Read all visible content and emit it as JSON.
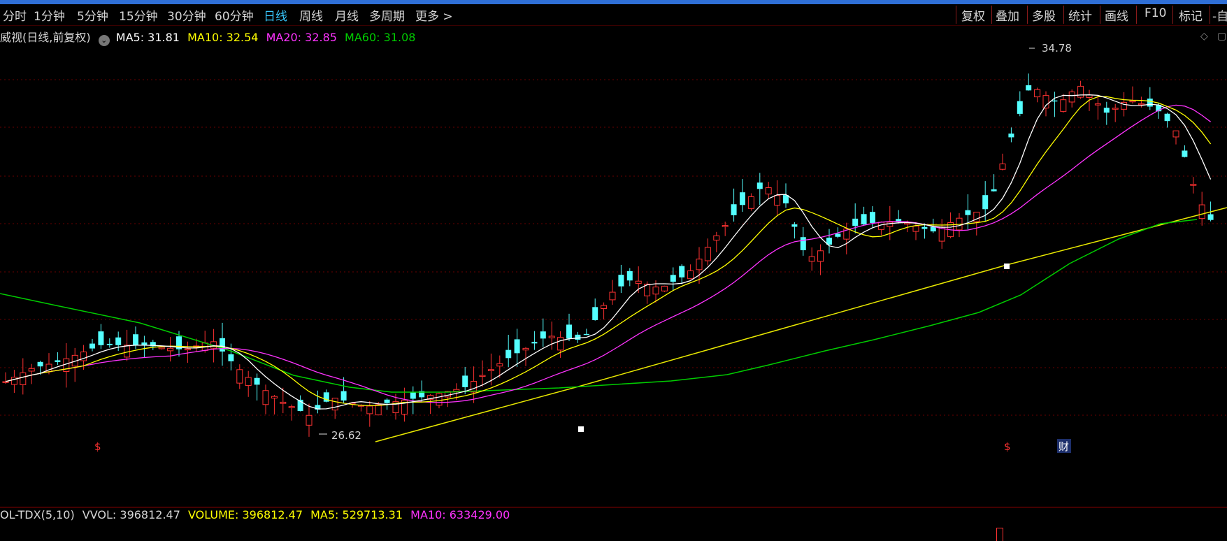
{
  "toolbar": {
    "periods": [
      {
        "label": "分时",
        "active": false
      },
      {
        "label": "1分钟",
        "active": false
      },
      {
        "label": "5分钟",
        "active": false
      },
      {
        "label": "15分钟",
        "active": false
      },
      {
        "label": "30分钟",
        "active": false
      },
      {
        "label": "60分钟",
        "active": false
      },
      {
        "label": "日线",
        "active": true
      },
      {
        "label": "周线",
        "active": false
      },
      {
        "label": "月线",
        "active": false
      },
      {
        "label": "多周期",
        "active": false
      },
      {
        "label": "更多 >",
        "active": false
      }
    ],
    "right_items": [
      "复权",
      "叠加",
      "多股",
      "统计",
      "画线",
      "F10",
      "标记",
      "-自"
    ]
  },
  "legend": {
    "name": "威视(日线,前复权)",
    "ma5": "MA5: 31.81",
    "ma10": "MA10: 32.54",
    "ma20": "MA20: 32.85",
    "ma60": "MA60: 31.08"
  },
  "annotations": {
    "high": "34.78",
    "low": "26.62",
    "marker_s": "$",
    "marker_cai": "财"
  },
  "volume": {
    "name": "OL-TDX(5,10)",
    "vvol": "VVOL: 396812.47",
    "volume": "VOLUME: 396812.47",
    "ma5": "MA5: 529713.31",
    "ma10": "MA10: 633429.00"
  },
  "colors": {
    "up": "#ff3232",
    "down": "#54ffff",
    "ma5": "#ffffff",
    "ma10": "#ffff00",
    "ma20": "#ff33ff",
    "ma60": "#00cc00",
    "trendline": "#e8e800"
  }
}
